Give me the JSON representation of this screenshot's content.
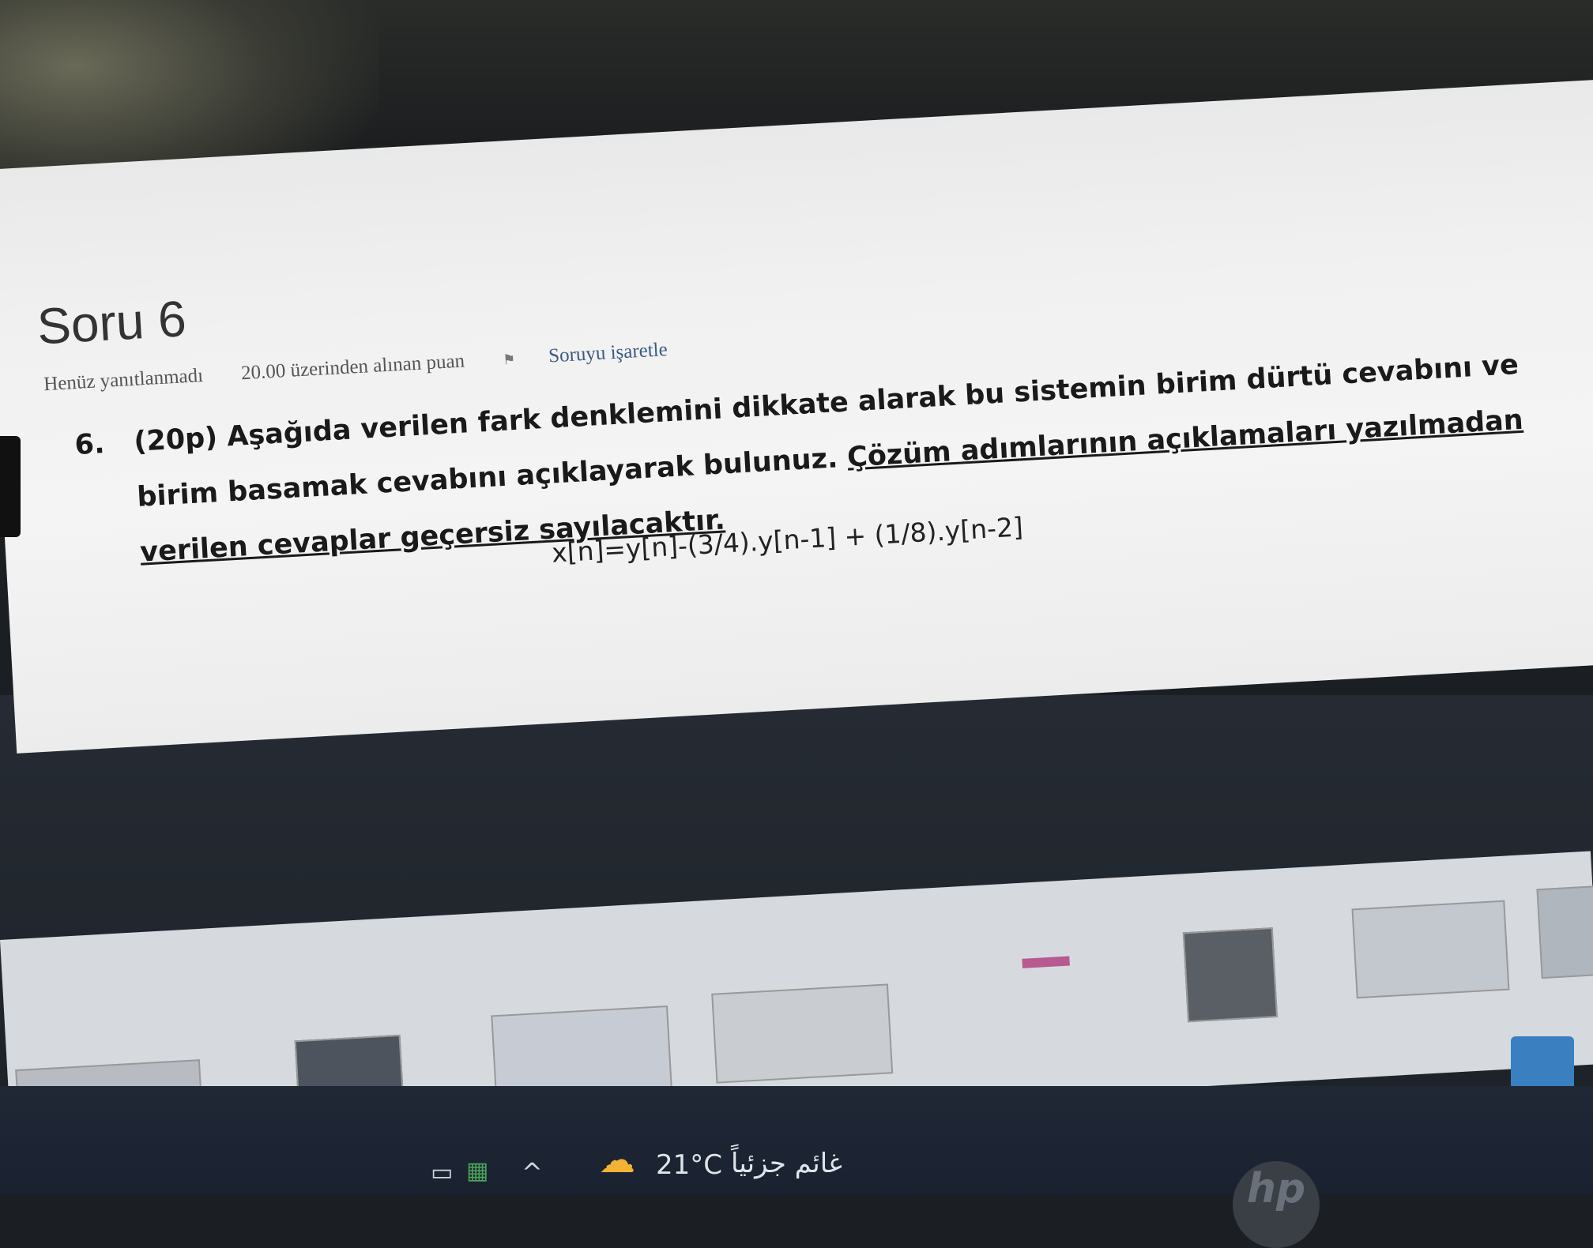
{
  "page": {
    "title": "Soru 6",
    "meta": {
      "status": "Henüz yanıtlanmadı",
      "points": "20.00 üzerinden alınan puan",
      "flag_label": "Soruyu işaretle"
    }
  },
  "question": {
    "number": "6.",
    "points_tag": "(20p)",
    "text_plain": " Aşağıda verilen fark denklemini dikkate alarak bu sistemin birim dürtü cevabını ve birim basamak cevabını açıklayarak bulunuz. ",
    "text_underlined": "Çözüm adımlarının açıklamaları yazılmadan verilen cevaplar geçersiz sayılacaktır.",
    "equation": "x[n]=y[n]-(3/4).y[n-1] + (1/8).y[n-2]"
  },
  "taskbar": {
    "temperature": "21°C",
    "weather_text": "غائم جزئياً",
    "icons": [
      "app-icon",
      "spreadsheet-icon",
      "chevron-up-icon",
      "partly-cloudy-icon",
      "news-widget-icon"
    ]
  },
  "colors": {
    "page_bg": "#f1f1f1",
    "taskbar_bg": "#1f2633",
    "weather_icon": "#f2b233",
    "flag_link": "#3b5a86"
  }
}
